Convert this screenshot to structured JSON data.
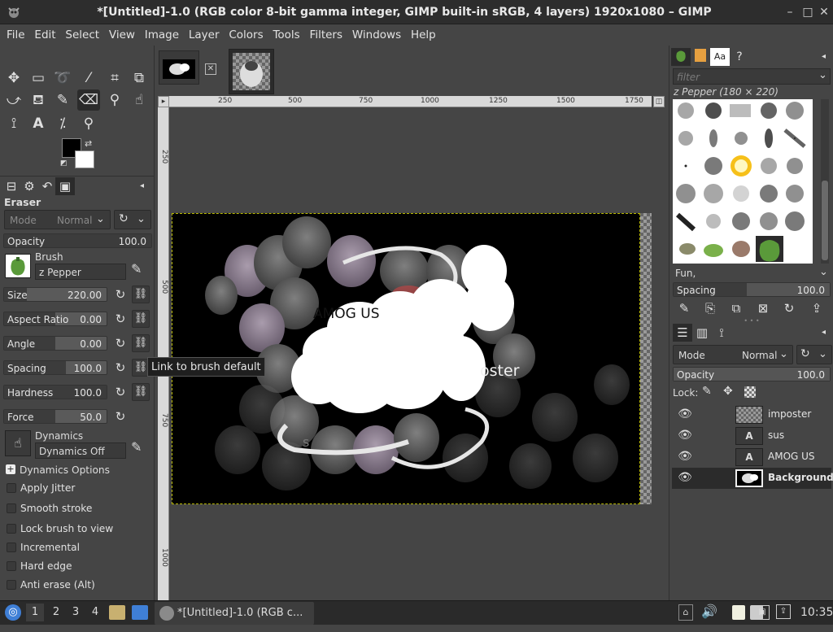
{
  "window": {
    "title": "*[Untitled]-1.0 (RGB color 8-bit gamma integer, GIMP built-in sRGB, 4 layers) 1920x1080 – GIMP",
    "minimize_glyph": "–",
    "maximize_glyph": "□",
    "close_glyph": "✕"
  },
  "menu": [
    "File",
    "Edit",
    "Select",
    "View",
    "Image",
    "Layer",
    "Colors",
    "Tools",
    "Filters",
    "Windows",
    "Help"
  ],
  "tool_options": {
    "title": "Eraser",
    "mode_label": "Mode",
    "mode_value": "Normal",
    "opacity": {
      "label": "Opacity",
      "value": "100.0",
      "fraction": 1.0
    },
    "brush_label": "Brush",
    "brush_name": "z Pepper",
    "size": {
      "label": "Size",
      "value": "220.00",
      "fraction": 0.22
    },
    "aspect_ratio": {
      "label": "Aspect Ratio",
      "value": "0.00",
      "fraction": 0.5
    },
    "angle": {
      "label": "Angle",
      "value": "0.00",
      "fraction": 0.5
    },
    "spacing": {
      "label": "Spacing",
      "value": "100.0",
      "fraction": 0.5
    },
    "hardness": {
      "label": "Hardness",
      "value": "100.0",
      "fraction": 1.0
    },
    "force": {
      "label": "Force",
      "value": "50.0",
      "fraction": 0.5
    },
    "dynamics_label": "Dynamics",
    "dynamics_value": "Dynamics Off",
    "dynamics_options": "Dynamics Options",
    "options": [
      "Apply Jitter",
      "Smooth stroke",
      "Lock brush to view",
      "Incremental",
      "Hard edge",
      "Anti erase  (Alt)"
    ],
    "tooltip": "Link to brush default"
  },
  "ruler": {
    "h_ticks": [
      "250",
      "500",
      "750",
      "1000",
      "1250",
      "1500",
      "1750"
    ],
    "v_ticks": [
      "250",
      "500",
      "750",
      "1000"
    ]
  },
  "canvas": {
    "text_amog": "AMOG US",
    "text_imposter": "oster",
    "text_sus": "s"
  },
  "brushes_panel": {
    "filter_placeholder": "filter",
    "brush_title": "z Pepper (180 × 220)",
    "tag_value": "Fun,",
    "spacing": {
      "label": "Spacing",
      "value": "100.0",
      "fraction": 1.0
    }
  },
  "layers_panel": {
    "mode_label": "Mode",
    "mode_value": "Normal",
    "opacity": {
      "label": "Opacity",
      "value": "100.0",
      "fraction": 1.0
    },
    "lock_label": "Lock:",
    "layers": [
      {
        "name": "imposter",
        "type": "checker",
        "bold": false
      },
      {
        "name": "sus",
        "type": "text",
        "bold": false
      },
      {
        "name": "AMOG US",
        "type": "text",
        "bold": false
      },
      {
        "name": "Background",
        "type": "image",
        "bold": true
      }
    ]
  },
  "taskbar": {
    "workspaces": [
      "1",
      "2",
      "3",
      "4"
    ],
    "task_label": "*[Untitled]-1.0 (RGB c...",
    "clock": "10:35"
  },
  "colors": {
    "panel_bg": "#454545",
    "dark_bg": "#2d2d2d",
    "canvas_bg": "#000000",
    "accent_blue": "#3f7fd6"
  }
}
